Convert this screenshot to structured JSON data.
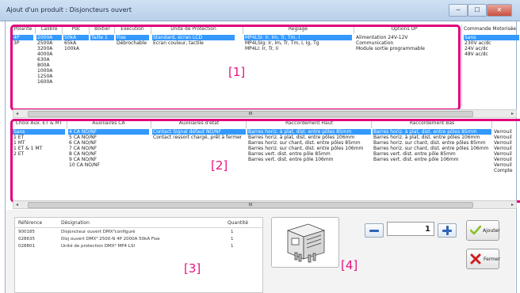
{
  "window": {
    "title": "Ajout d'un produit : Disjoncteurs ouvert",
    "min_label": "─",
    "max_label": "☐",
    "close_label": "✕"
  },
  "section1": {
    "label": "[1]",
    "columns": [
      {
        "header": "Polarité",
        "items": [
          "4P",
          "3P"
        ],
        "selected": 0
      },
      {
        "header": "Calibre",
        "items": [
          "2000A",
          "2500A",
          "3200A",
          "4000A",
          "630A",
          "800A",
          "1000A",
          "1250A",
          "1600A"
        ],
        "selected": 0
      },
      {
        "header": "Pdc",
        "items": [
          "50kA",
          "65kA",
          "100kA"
        ],
        "selected": 0
      },
      {
        "header": "Boitier",
        "items": [
          "Taille 1"
        ],
        "selected": 0
      },
      {
        "header": "Execution",
        "items": [
          "Fixe",
          "Débrochable"
        ],
        "selected": 0
      },
      {
        "header": "Unité de Protection",
        "items": [
          "Standard, écran LCD",
          "Ecran couleur, tactile"
        ],
        "selected": 0
      },
      {
        "header": "Réglage",
        "items": [
          "MP4LSI: Ir, Im, Tr, Tm, I",
          "MP4LSIg: Ir, Im, Tr, Tm, I, Ig, Tg",
          "MP4LI: Ir, Tr, Ii"
        ],
        "selected": 0
      },
      {
        "header": "Options UP",
        "items": [
          "Alimentation 24V-12V",
          "Communication",
          "Module sortie programmable"
        ],
        "selected": -1
      }
    ]
  },
  "right_panel": {
    "header": "Commande Motorisée",
    "items": [
      "Sans",
      "230V ac/dc",
      "24V ac/dc",
      "48V ac/dc"
    ],
    "selected": 0
  },
  "section2": {
    "label": "[2]",
    "columns": [
      {
        "header": "Choix Aux. ET & MT",
        "items": [
          "Sans",
          "1 ET",
          "1 MT",
          "1 ET & 1 MT",
          "2 ET"
        ],
        "selected": 0
      },
      {
        "header": "Auxiliaires CA",
        "items": [
          "4 CA NO/NF",
          "5 CA NO/NF",
          "6 CA NO/NF",
          "7 CA NO/NF",
          "8 CA NO/NF",
          "9 CA NO/NF",
          "10 CA NO/NF"
        ],
        "selected": 0
      },
      {
        "header": "Auxiliaires d'état",
        "items": [
          "Contact Signal défaut NO/NF",
          "Contact ressort chargé, prêt à fermer"
        ],
        "selected": 0
      },
      {
        "header": "Raccordement Haut",
        "items": [
          "Barres horiz. à plat, dist. entre pôles 85mm",
          "Barres horiz. à plat, dist. entre pôles 106mm",
          "Barres horiz. sur chant, dist. entre pôles 85mm",
          "Barres horiz. sur chant, dist. entre pôles 106mm",
          "Barres vert. dist. entre pôle 85mm",
          "Barres vert. dist. entre pôle 106mm"
        ],
        "selected": 0
      },
      {
        "header": "Raccordement Bas",
        "items": [
          "Barres horiz. à plat, dist. entre pôles 85mm",
          "Barres horiz. à plat, dist. entre pôles 106mm",
          "Barres horiz. sur chant, dist. entre pôles 85mm",
          "Barres horiz. sur chant, dist. entre pôles 106mm",
          "Barres vert. dist. entre pôle 85mm",
          "Barres vert. dist. entre pôle 106mm"
        ],
        "selected": 0
      },
      {
        "header": "",
        "items": [
          "Verrouil",
          "Verrouil",
          "Verrouil",
          "Verrouil",
          "Verrouil",
          "Verrouil",
          "Verrouil",
          "Compte"
        ],
        "selected": -1
      }
    ]
  },
  "section3": {
    "label": "[3]",
    "headers": {
      "ref": "Référence",
      "designation": "Désignation",
      "qty": "Quantité"
    },
    "rows": [
      {
        "ref": "900185",
        "designation": "Disjoncteur ouvert DMX³configuré",
        "qty": "1"
      },
      {
        "ref": "028635",
        "designation": "Disj ouvert DMX³ 2500-N 4P 2000A 50kA Fixe",
        "qty": "1"
      },
      {
        "ref": "028801",
        "designation": "Unité de protection DMX³ MP4 LSI",
        "qty": "1"
      }
    ]
  },
  "section4": {
    "label": "[4]"
  },
  "quantity": {
    "value": "1",
    "minus": "−",
    "plus": "+"
  },
  "buttons": {
    "add": "Ajouter",
    "close": "Fermer"
  },
  "scroll": {
    "left": "◂",
    "right": "▸",
    "grip": "III"
  },
  "colors": {
    "accent": "#e0007a",
    "selection": "#3399ff",
    "add_check": "#8bbf2a",
    "close_x": "#cc1f1f"
  }
}
